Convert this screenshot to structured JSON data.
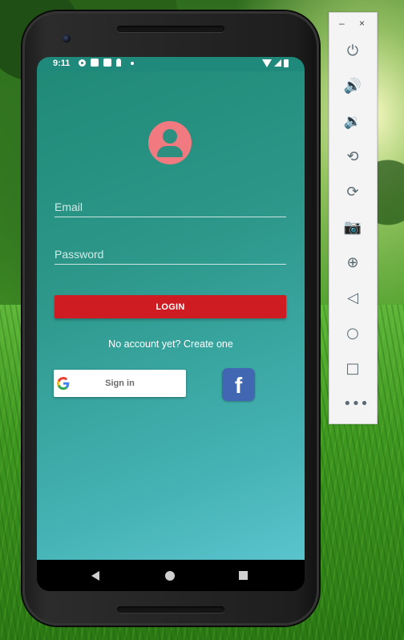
{
  "status_bar": {
    "time": "9:11"
  },
  "login": {
    "email_placeholder": "Email",
    "password_placeholder": "Password",
    "login_label": "LOGIN",
    "create_account_text": "No account yet? Create one",
    "google_label": "Sign in",
    "facebook_glyph": "f"
  },
  "toolbar": {
    "minimize": "–",
    "close": "×",
    "items": [
      "power-icon",
      "volume-up-icon",
      "volume-down-icon",
      "rotate-left-icon",
      "rotate-right-icon",
      "camera-icon",
      "zoom-icon",
      "back-icon",
      "home-icon",
      "overview-icon",
      "more-icon"
    ]
  },
  "colors": {
    "app_gradient_start": "#218a77",
    "app_gradient_end": "#5ac4cd",
    "login_button": "#cf1c22",
    "avatar": "#f07a80",
    "facebook": "#4267b2"
  }
}
